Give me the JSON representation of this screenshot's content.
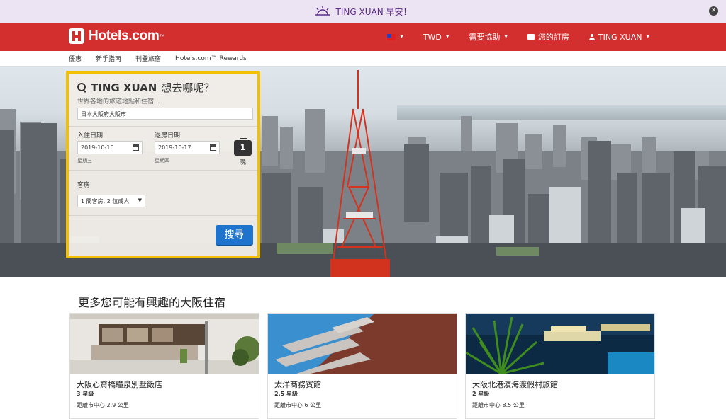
{
  "greeting": {
    "text": "TING XUAN 早安！",
    "icon": "sun-icon"
  },
  "header": {
    "brand": "Hotels.com",
    "brand_tm": "™",
    "currency": "TWD",
    "help": "需要協助",
    "bookings": "您的訂房",
    "user": "TING XUAN"
  },
  "subnav": [
    "優惠",
    "新手指南",
    "刊登旅宿",
    "Hotels.com™ Rewards"
  ],
  "search": {
    "title_name": "TING XUAN",
    "title_q": "想去哪呢？",
    "subtitle": "世界各地的旅遊地點和住宿...",
    "destination": "日本大阪府大阪市",
    "checkin_label": "入住日期",
    "checkin_value": "2019-10-16",
    "checkin_weekday": "星期三",
    "checkout_label": "退房日期",
    "checkout_value": "2019-10-17",
    "checkout_weekday": "星期四",
    "nights": "1",
    "nights_label": "晚",
    "rooms_label": "客房",
    "rooms_value": "1 間客房, 2 位成人",
    "button": "搜尋"
  },
  "recommendations": {
    "title": "更多您可能有興趣的大阪住宿",
    "cards": [
      {
        "name": "大阪心齋橋瞳泉別墅飯店",
        "stars": "3 星級",
        "distance": "距離市中心 2.9 公里"
      },
      {
        "name": "太洋商務賓館",
        "stars": "2.5 星級",
        "distance": "距離市中心 6 公里"
      },
      {
        "name": "大阪北港濱海渡假村旅館",
        "stars": "2 星級",
        "distance": "距離市中心 8.5 公里"
      }
    ]
  },
  "colors": {
    "header": "#d32f2f",
    "accent": "#f2c000",
    "button": "#1e74cc",
    "banner": "#ede4f3"
  }
}
